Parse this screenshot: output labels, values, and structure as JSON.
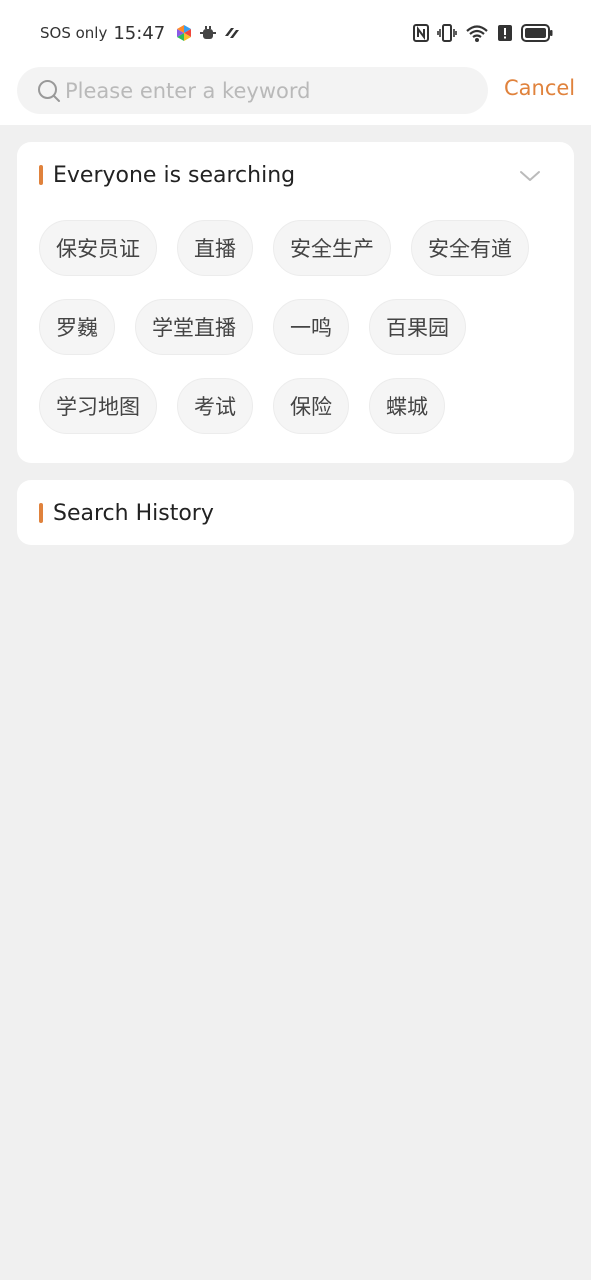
{
  "status_bar": {
    "carrier": "SOS only",
    "time": "15:47",
    "left_icons": [
      "colorful-app-icon",
      "android-bug-icon",
      "link-icon"
    ],
    "right_icons": [
      "nfc-icon",
      "vibrate-icon",
      "wifi-icon",
      "alert-icon",
      "battery-icon"
    ]
  },
  "search": {
    "placeholder": "Please enter a keyword",
    "value": "",
    "cancel_label": "Cancel"
  },
  "hot_searches": {
    "title": "Everyone is searching",
    "rows": [
      [
        "保安员证",
        "直播",
        "安全生产",
        "安全有道"
      ],
      [
        "罗巍",
        "学堂直播",
        "一鸣",
        "百果园"
      ],
      [
        "学习地图",
        "考试",
        "保险",
        "蝶城"
      ]
    ]
  },
  "history": {
    "title": "Search History"
  },
  "colors": {
    "accent": "#e0823c",
    "background": "#f0f0f0",
    "card": "#ffffff",
    "tag_bg": "#f5f5f5"
  }
}
